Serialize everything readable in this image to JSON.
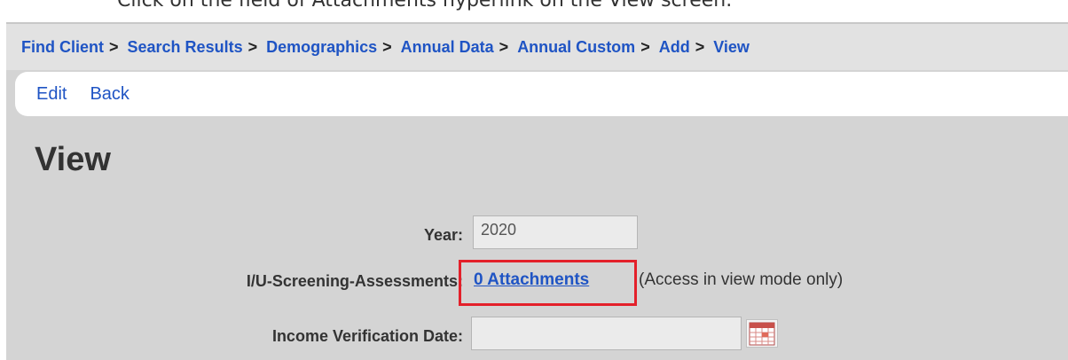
{
  "instruction": "Click on the field of Attachments hyperlink on the View screen.",
  "breadcrumb": [
    {
      "label": "Find Client"
    },
    {
      "label": "Search Results"
    },
    {
      "label": "Demographics"
    },
    {
      "label": "Annual Data"
    },
    {
      "label": "Annual Custom"
    },
    {
      "label": "Add"
    },
    {
      "label": "View"
    }
  ],
  "breadcrumb_separator": ">",
  "actions": {
    "edit": "Edit",
    "back": "Back"
  },
  "page_title": "View",
  "fields": {
    "year": {
      "label": "Year:",
      "value": "2020"
    },
    "screening": {
      "label": "I/U-Screening-Assessments:",
      "link": "0 Attachments",
      "note": "(Access in view mode only)"
    },
    "income_date": {
      "label": "Income Verification Date:",
      "value": ""
    }
  },
  "colors": {
    "link": "#1f54c4",
    "highlight": "#e3202a",
    "background": "#d4d4d4"
  },
  "icons": {
    "date_picker": "calendar-icon"
  }
}
